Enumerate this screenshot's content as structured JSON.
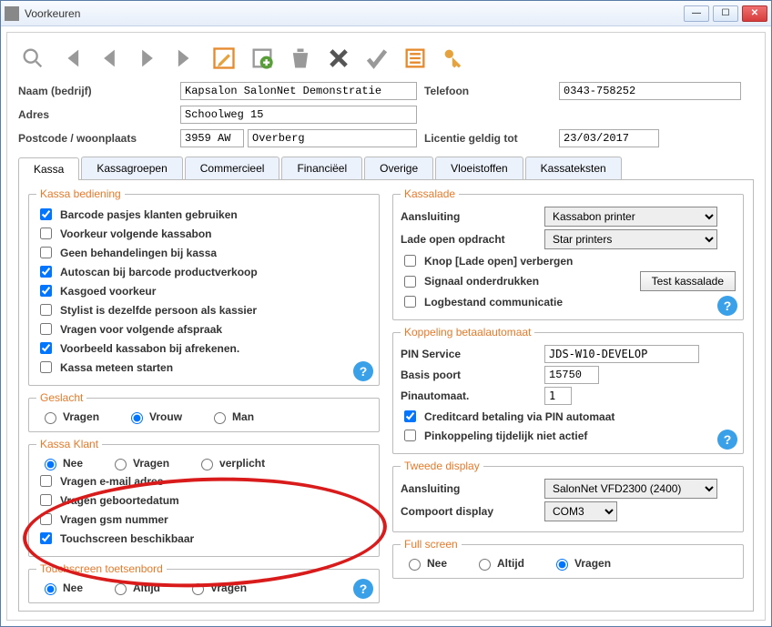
{
  "window": {
    "title": "Voorkeuren"
  },
  "header": {
    "naam_label": "Naam (bedrijf)",
    "naam": "Kapsalon SalonNet Demonstratie",
    "adres_label": "Adres",
    "adres": "Schoolweg 15",
    "postcode_label": "Postcode / woonplaats",
    "postcode": "3959 AW",
    "plaats": "Overberg",
    "telefoon_label": "Telefoon",
    "telefoon": "0343-758252",
    "licentie_label": "Licentie geldig tot",
    "licentie": "23/03/2017"
  },
  "tabs": [
    "Kassa",
    "Kassagroepen",
    "Commercieel",
    "Financiëel",
    "Overige",
    "Vloeistoffen",
    "Kassateksten"
  ],
  "kassa_bediening": {
    "legend": "Kassa bediening",
    "items": [
      {
        "label": "Barcode pasjes klanten gebruiken",
        "checked": true
      },
      {
        "label": "Voorkeur volgende kassabon",
        "checked": false
      },
      {
        "label": "Geen behandelingen bij kassa",
        "checked": false
      },
      {
        "label": "Autoscan bij barcode productverkoop",
        "checked": true
      },
      {
        "label": "Kasgoed voorkeur",
        "checked": true
      },
      {
        "label": "Stylist is dezelfde persoon als kassier",
        "checked": false
      },
      {
        "label": "Vragen voor volgende afspraak",
        "checked": false
      },
      {
        "label": "Voorbeeld kassabon bij afrekenen.",
        "checked": true
      },
      {
        "label": "Kassa meteen starten",
        "checked": false
      }
    ]
  },
  "geslacht": {
    "legend": "Geslacht",
    "options": [
      "Vragen",
      "Vrouw",
      "Man"
    ],
    "selected": "Vrouw"
  },
  "kassa_klant": {
    "legend": "Kassa Klant",
    "options": [
      "Nee",
      "Vragen",
      "verplicht"
    ],
    "selected": "Nee",
    "checks": [
      {
        "label": "Vragen e-mail adres",
        "checked": false
      },
      {
        "label": "Vragen geboortedatum",
        "checked": false
      },
      {
        "label": "Vragen gsm nummer",
        "checked": false
      },
      {
        "label": "Touchscreen beschikbaar",
        "checked": true
      }
    ]
  },
  "touchscreen": {
    "legend": "Touchscreen toetsenbord",
    "options": [
      "Nee",
      "Altijd",
      "Vragen"
    ],
    "selected": "Nee"
  },
  "kassalade": {
    "legend": "Kassalade",
    "aansluiting_label": "Aansluiting",
    "aansluiting_value": "Kassabon printer",
    "lade_open_label": "Lade open opdracht",
    "lade_open_value": "Star printers",
    "knop_verbergen": {
      "label": "Knop [Lade open] verbergen",
      "checked": false
    },
    "signaal": {
      "label": "Signaal onderdrukken",
      "checked": false
    },
    "test_btn": "Test kassalade",
    "logbestand": {
      "label": "Logbestand communicatie",
      "checked": false
    }
  },
  "koppeling": {
    "legend": "Koppeling betaalautomaat",
    "pin_service_label": "PIN Service",
    "pin_service": "JDS-W10-DEVELOP",
    "basis_poort_label": "Basis poort",
    "basis_poort": "15750",
    "pinautomaat_label": "Pinautomaat.",
    "pinautomaat": "1",
    "creditcard": {
      "label": "Creditcard betaling via PIN automaat",
      "checked": true
    },
    "niet_actief": {
      "label": "Pinkoppeling tijdelijk niet actief",
      "checked": false
    }
  },
  "tweede_display": {
    "legend": "Tweede display",
    "aansluiting_label": "Aansluiting",
    "aansluiting_value": "SalonNet VFD2300 (2400)",
    "compoort_label": "Compoort display",
    "compoort_value": "COM3"
  },
  "full_screen": {
    "legend": "Full screen",
    "options": [
      "Nee",
      "Altijd",
      "Vragen"
    ],
    "selected": "Vragen"
  }
}
